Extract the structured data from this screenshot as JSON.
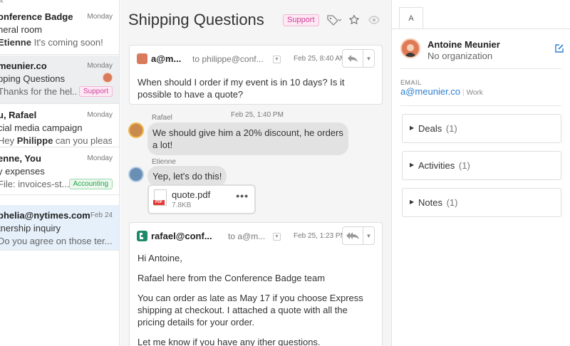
{
  "list": {
    "cut_label": "k",
    "conversations": [
      {
        "sender": "onference Badge",
        "date": "Monday",
        "subject": "neral room",
        "preview_bold": "Etienne",
        "preview": " It's coming soon!"
      },
      {
        "sender": "meunier.co",
        "date": "Monday",
        "subject": "pping Questions",
        "preview_bold": "",
        "preview": "Thanks for the hel...",
        "tag": "Support"
      },
      {
        "sender": "u, Rafael",
        "date": "Monday",
        "subject": "cial media campaign",
        "preview_bold": "",
        "preview": "Hey ",
        "preview_bold2": "Philippe",
        "preview2": " can you pleas..."
      },
      {
        "sender": "enne, You",
        "date": "Monday",
        "subject": "y expenses",
        "preview_bold": "",
        "preview": "File: invoices-st...",
        "tag": "Accounting"
      },
      {
        "sender": "phelia@nytimes.com",
        "date": "Feb 24",
        "subject": "tnership inquiry",
        "preview_bold": "",
        "preview": "Do you agree on those ter..."
      }
    ]
  },
  "thread": {
    "title": "Shipping Questions",
    "tag": "Support",
    "icons": {
      "tag": "tag-icon",
      "star": "star-icon",
      "watch": "eye-icon"
    },
    "first_message": {
      "from": "a@m...",
      "to": "to philippe@conf...",
      "date": "Feb 25, 8:40 AM",
      "body": "When should I order if my event is in 10 days? Is it possible to have a quote?"
    },
    "comments": [
      {
        "name": "Rafael",
        "date": "Feb 25, 1:40 PM",
        "text": "We should give him a 20% discount, he orders a lot!"
      },
      {
        "name": "Etienne",
        "text": "Yep, let's do this!"
      }
    ],
    "attachment": {
      "name": "quote.pdf",
      "size": "7.8KB",
      "type_label": "PDF",
      "more": "•••"
    },
    "second_message": {
      "from": "rafael@conf...",
      "to": "to a@m...",
      "date": "Feb 25, 1:23 PM",
      "paragraphs": [
        "Hi Antoine,",
        "Rafael here from the Conference Badge team",
        "You can order as late as May 17 if you choose Express shipping at checkout. I attached a quote with all the pricing details for your order.",
        "Let me know if you have any ither questions."
      ]
    }
  },
  "contact": {
    "tab": "A",
    "name": "Antoine Meunier",
    "organization": "No organization",
    "email_label": "EMAIL",
    "email": "a@meunier.co",
    "email_separator": "|",
    "email_kind": "Work",
    "sections": [
      {
        "title": "Deals",
        "count": "(1)"
      },
      {
        "title": "Activities",
        "count": "(1)"
      },
      {
        "title": "Notes",
        "count": "(1)"
      }
    ]
  },
  "colors": {
    "accent_blue": "#2f7fd1",
    "support_pink": "#d2409a",
    "accounting_green": "#2aa14a",
    "pdf_red": "#e53935"
  }
}
